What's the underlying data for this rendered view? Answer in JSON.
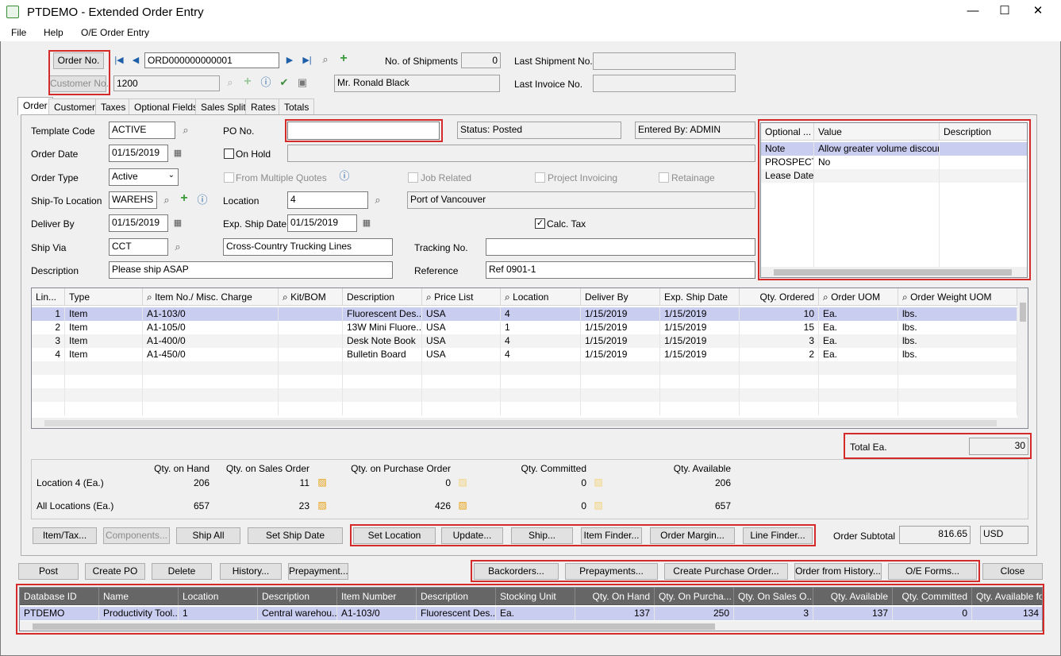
{
  "window": {
    "title": "PTDEMO - Extended Order Entry",
    "minimize": "—",
    "maximize": "☐",
    "close": "✕"
  },
  "menu": [
    "File",
    "Help",
    "O/E Order Entry"
  ],
  "header": {
    "order_no_btn": "Order No.",
    "order_no": "ORD000000000001",
    "customer_no_btn": "Customer No.",
    "customer_no": "1200",
    "customer_name": "Mr. Ronald Black",
    "shipments_label": "No. of Shipments",
    "shipments": "0",
    "last_shipment_label": "Last Shipment No.",
    "last_shipment": "",
    "last_invoice_label": "Last Invoice No.",
    "last_invoice": ""
  },
  "tabs": [
    "Order",
    "Customer",
    "Taxes",
    "Optional Fields",
    "Sales Split",
    "Rates",
    "Totals"
  ],
  "order": {
    "template_code_label": "Template Code",
    "template_code": "ACTIVE",
    "po_label": "PO No.",
    "po_value": "",
    "status": "Status: Posted",
    "entered_by": "Entered By: ADMIN",
    "order_date_label": "Order Date",
    "order_date": "01/15/2019",
    "on_hold": "On Hold",
    "order_type_label": "Order Type",
    "order_type": "Active",
    "from_multiple_quotes": "From Multiple Quotes",
    "job_related": "Job Related",
    "project_invoicing": "Project Invoicing",
    "retainage": "Retainage",
    "ship_to_label": "Ship-To Location",
    "ship_to": "WAREHS",
    "location_label": "Location",
    "location": "4",
    "location_desc": "Port of Vancouver",
    "deliver_by_label": "Deliver By",
    "deliver_by": "01/15/2019",
    "exp_ship_label": "Exp. Ship Date",
    "exp_ship": "01/15/2019",
    "calc_tax": "Calc. Tax",
    "ship_via_label": "Ship Via",
    "ship_via": "CCT",
    "ship_via_desc": "Cross-Country Trucking Lines",
    "tracking_label": "Tracking No.",
    "tracking": "",
    "description_label": "Description",
    "description": "Please ship ASAP",
    "reference_label": "Reference",
    "reference": "Ref 0901-1"
  },
  "optional_fields": {
    "headers": [
      "Optional ...",
      "Value",
      "Description"
    ],
    "rows": [
      [
        "Note",
        "Allow greater volume discount",
        ""
      ],
      [
        "PROSPECT",
        "No",
        ""
      ],
      [
        "Lease Date",
        "",
        ""
      ]
    ]
  },
  "lines": {
    "headers": [
      "Lin...",
      "Type",
      "Item No./ Misc. Charge",
      "Kit/BOM",
      "Description",
      "Price List",
      "Location",
      "Deliver By",
      "Exp. Ship Date",
      "Qty. Ordered",
      "Order UOM",
      "Order Weight UOM"
    ],
    "rows": [
      [
        "1",
        "Item",
        "A1-103/0",
        "",
        "Fluorescent Des...",
        "USA",
        "4",
        "1/15/2019",
        "1/15/2019",
        "10",
        "Ea.",
        "lbs."
      ],
      [
        "2",
        "Item",
        "A1-105/0",
        "",
        "13W Mini Fluore...",
        "USA",
        "1",
        "1/15/2019",
        "1/15/2019",
        "15",
        "Ea.",
        "lbs."
      ],
      [
        "3",
        "Item",
        "A1-400/0",
        "",
        "Desk Note Book",
        "USA",
        "4",
        "1/15/2019",
        "1/15/2019",
        "3",
        "Ea.",
        "lbs."
      ],
      [
        "4",
        "Item",
        "A1-450/0",
        "",
        "Bulletin Board",
        "USA",
        "4",
        "1/15/2019",
        "1/15/2019",
        "2",
        "Ea.",
        "lbs."
      ]
    ]
  },
  "total": {
    "label": "Total Ea.",
    "value": "30"
  },
  "qty": {
    "headers": [
      "Qty. on Hand",
      "Qty. on Sales Order",
      "Qty. on Purchase Order",
      "Qty. Committed",
      "Qty. Available"
    ],
    "loc_label": "Location  4 (Ea.)",
    "loc": [
      "206",
      "11",
      "0",
      "0",
      "206"
    ],
    "all_label": "All Locations (Ea.)",
    "all": [
      "657",
      "23",
      "426",
      "0",
      "657"
    ]
  },
  "line_buttons": [
    "Item/Tax...",
    "Components...",
    "Ship All",
    "Set Ship Date",
    "Set Location",
    "Update...",
    "Ship...",
    "Item Finder...",
    "Order Margin...",
    "Line Finder..."
  ],
  "subtotal": {
    "label": "Order Subtotal",
    "value": "816.65",
    "currency": "USD"
  },
  "bottom_buttons": [
    "Post",
    "Create PO",
    "Delete",
    "History...",
    "Prepayment...",
    "Backorders...",
    "Prepayments...",
    "Create Purchase Order...",
    "Order from History...",
    "O/E Forms...",
    "Close"
  ],
  "inventory": {
    "headers": [
      "Database ID",
      "Name",
      "Location",
      "Description",
      "Item Number",
      "Description",
      "Stocking Unit",
      "Qty. On Hand",
      "Qty. On Purcha...",
      "Qty. On Sales O...",
      "Qty. Available",
      "Qty. Committed",
      "Qty. Available fo..."
    ],
    "rows": [
      [
        "PTDEMO",
        "Productivity Tool...",
        "1",
        "Central warehou...",
        "A1-103/0",
        "Fluorescent Des...",
        "Ea.",
        "137",
        "250",
        "3",
        "137",
        "0",
        "134"
      ]
    ]
  }
}
